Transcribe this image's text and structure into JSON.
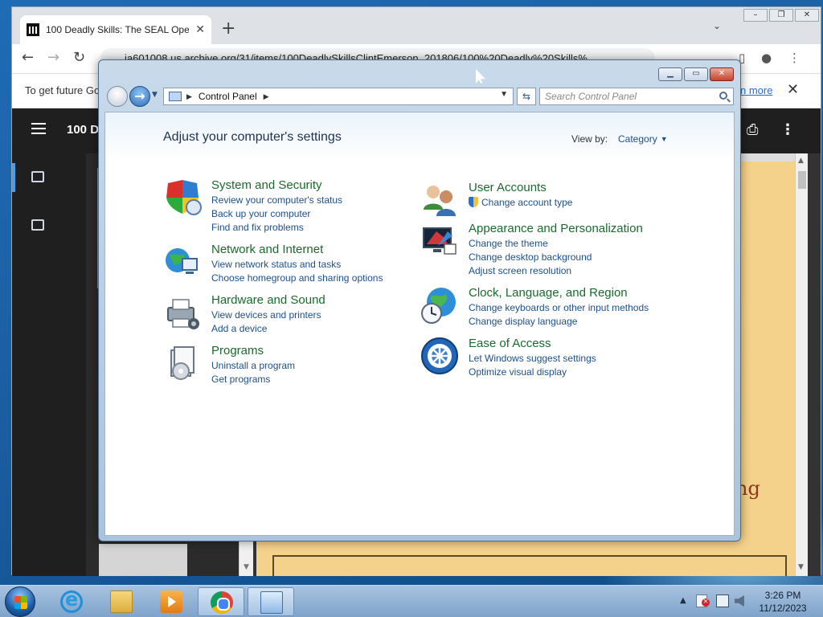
{
  "browser": {
    "tab_title": "100 Deadly Skills: The SEAL Oper",
    "url": "ia601008.us.archive.org/31/items/100DeadlySkillsClintEmerson_201806/100%20Deadly%20Skills%",
    "infobar_text": "To get future Go",
    "infobar_link": "n more"
  },
  "reader": {
    "title": "100 De",
    "page_word": "ng"
  },
  "control_panel": {
    "address_path": "Control Panel",
    "search_placeholder": "Search Control Panel",
    "heading": "Adjust your computer's settings",
    "view_by_label": "View by:",
    "view_by_value": "Category",
    "categories": [
      {
        "title": "System and Security",
        "icon": "shield-icon",
        "links": [
          "Review your computer's status",
          "Back up your computer",
          "Find and fix problems"
        ]
      },
      {
        "title": "Network and Internet",
        "icon": "network-globe-icon",
        "links": [
          "View network status and tasks",
          "Choose homegroup and sharing options"
        ]
      },
      {
        "title": "Hardware and Sound",
        "icon": "printer-icon",
        "links": [
          "View devices and printers",
          "Add a device"
        ]
      },
      {
        "title": "Programs",
        "icon": "programs-icon",
        "links": [
          "Uninstall a program",
          "Get programs"
        ]
      },
      {
        "title": "User Accounts",
        "icon": "users-icon",
        "links": [
          "Change account type"
        ]
      },
      {
        "title": "Appearance and Personalization",
        "icon": "monitor-paint-icon",
        "links": [
          "Change the theme",
          "Change desktop background",
          "Adjust screen resolution"
        ]
      },
      {
        "title": "Clock, Language, and Region",
        "icon": "globe-clock-icon",
        "links": [
          "Change keyboards or other input methods",
          "Change display language"
        ]
      },
      {
        "title": "Ease of Access",
        "icon": "ease-of-access-icon",
        "links": [
          "Let Windows suggest settings",
          "Optimize visual display"
        ]
      }
    ]
  },
  "taskbar": {
    "time": "3:26 PM",
    "date": "11/12/2023"
  },
  "colors": {
    "category_title": "#1a6a2e",
    "link": "#1e4f8c",
    "chrome_link": "#1a73e8"
  }
}
